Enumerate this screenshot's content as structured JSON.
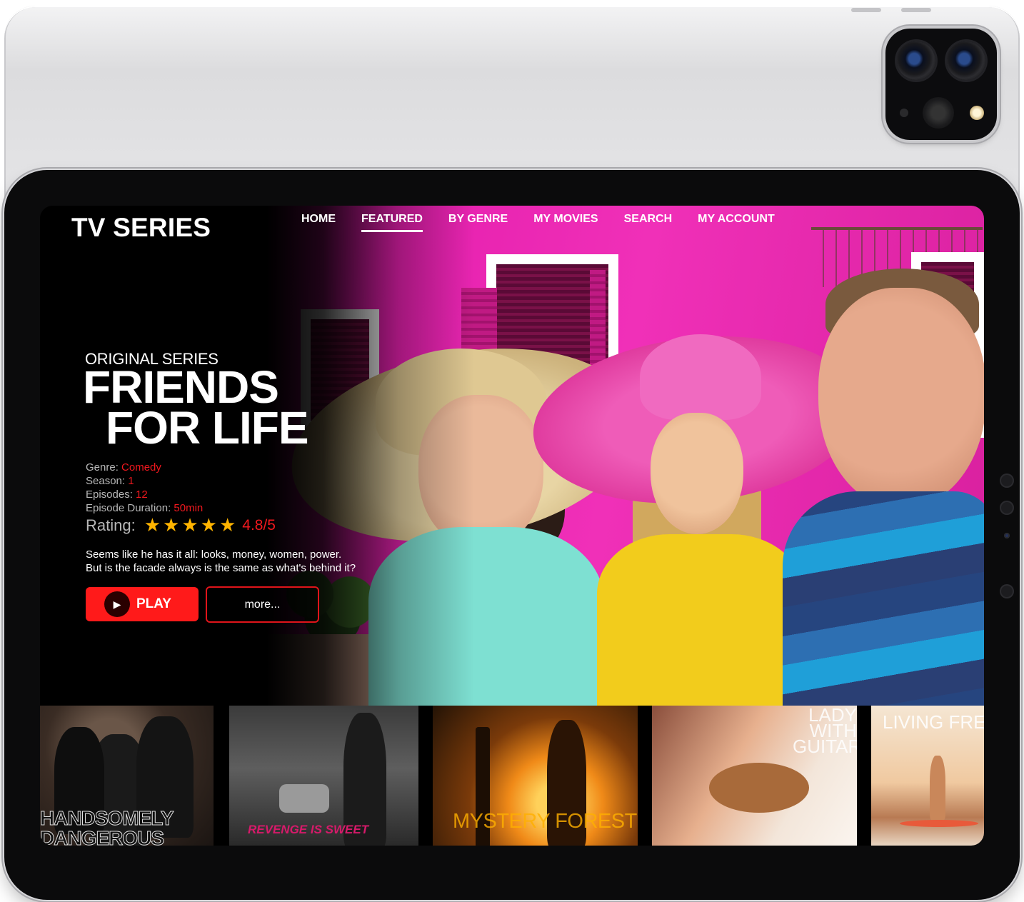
{
  "app": {
    "title": "TV SERIES"
  },
  "nav": {
    "items": [
      {
        "label": "HOME",
        "active": false
      },
      {
        "label": "FEATURED",
        "active": true
      },
      {
        "label": "BY GENRE",
        "active": false
      },
      {
        "label": "MY MOVIES",
        "active": false
      },
      {
        "label": "SEARCH",
        "active": false
      },
      {
        "label": "MY ACCOUNT",
        "active": false
      }
    ]
  },
  "hero": {
    "kicker": "ORIGINAL SERIES",
    "title_line1": "FRIENDS",
    "title_line2": "FOR LIFE",
    "meta": [
      {
        "label": "Genre:",
        "value": "Comedy"
      },
      {
        "label": "Season:",
        "value": "1"
      },
      {
        "label": "Episodes:",
        "value": "12"
      },
      {
        "label": "Episode Duration:",
        "value": "50min"
      }
    ],
    "rating_label": "Rating:",
    "rating_stars": 5,
    "rating_value": "4.8/5",
    "synopsis_line1": "Seems like he has it all: looks, money, women, power.",
    "synopsis_line2": "But is the facade always is the same as what's behind it?",
    "play_label": "PLAY",
    "more_label": "more..."
  },
  "thumbnails": [
    {
      "title": "HANDSOMELY DANGEROUS"
    },
    {
      "title": "REVENGE IS SWEET"
    },
    {
      "title": "MYSTERY FOREST"
    },
    {
      "title": "LADY WITH GUITAR"
    },
    {
      "title": "LIVING FREE"
    }
  ],
  "colors": {
    "accent_red": "#ff1a1a",
    "value_red": "#f0181e",
    "star_gold": "#ffb400",
    "screen_bg": "#000000"
  },
  "icons": [
    "play-icon",
    "star-icon",
    "camera-icon"
  ]
}
